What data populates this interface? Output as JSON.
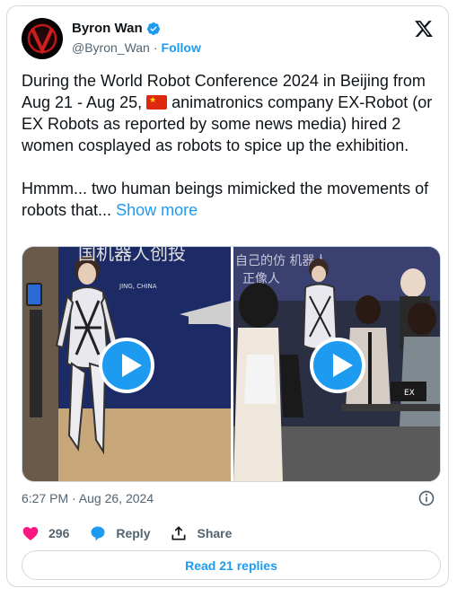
{
  "author": {
    "name": "Byron Wan",
    "handle": "@Byron_Wan",
    "separator": "·",
    "follow_label": "Follow"
  },
  "post": {
    "text_before_flag": "During the World Robot Conference 2024 in Beijing from Aug 21 - Aug 25, ",
    "flag_icon": "china-flag-icon",
    "text_after_flag": " animatronics company EX-Robot (or EX Robots as reported by some news media) hired 2 women cosplayed as robots to spice up the exhibition.\n\nHmmm... two human beings mimicked the movements of robots that... ",
    "show_more_label": "Show more",
    "timestamp": "6:27 PM · Aug 26, 2024"
  },
  "media": {
    "left_banner_text": "国机器人创投",
    "left_small_text": "JING, CHINA",
    "right_banner_text": "自己的仿 机器人",
    "right_banner_text2": "正像人",
    "box_label": "EX"
  },
  "actions": {
    "likes_count": "296",
    "reply_label": "Reply",
    "share_label": "Share"
  },
  "replies_button_label": "Read 21 replies",
  "colors": {
    "accent": "#1d9bf0",
    "like": "#f91880",
    "text": "#0f1419",
    "muted": "#536471",
    "border": "#cfd9de"
  }
}
